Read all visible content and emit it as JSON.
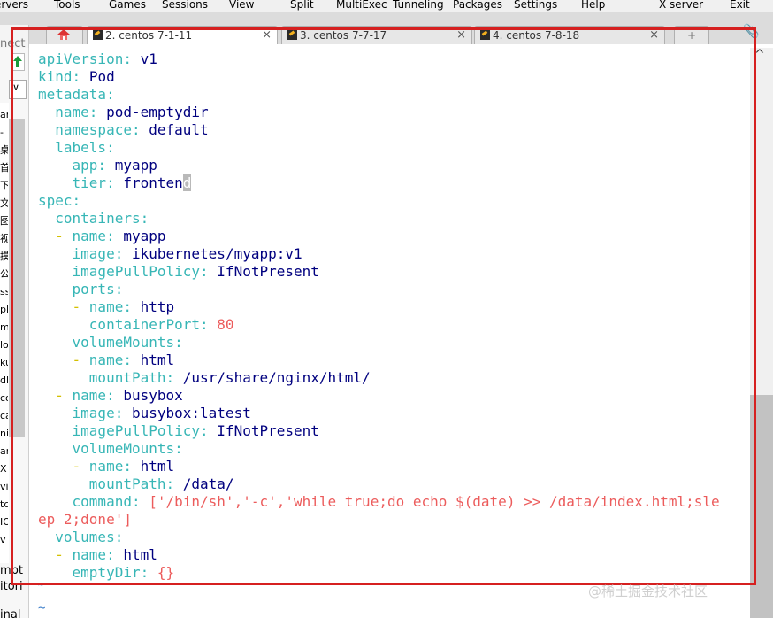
{
  "menu": {
    "items": [
      "ervers",
      "Tools",
      "Games",
      "Sessions",
      "View",
      "Split",
      "MultiExec",
      "Tunneling",
      "Packages",
      "Settings",
      "Help",
      "X server",
      "Exit"
    ]
  },
  "tabs": [
    {
      "label": "2. centos 7-1-11",
      "active": true
    },
    {
      "label": "3. centos 7-7-17",
      "active": false
    },
    {
      "label": "4. centos 7-8-18",
      "active": false
    }
  ],
  "sidebar": {
    "search_placeholder": "nect",
    "rows": [
      "ar",
      "桌",
      "首",
      "下",
      "文",
      "图",
      "视",
      "摸",
      "公",
      "ss",
      "pl",
      "m",
      "lo",
      "ku",
      "dl",
      "co",
      "ca",
      "ni",
      "an",
      "X",
      "vi",
      "tc",
      "IO",
      "v"
    ],
    "bottom": [
      "mpt",
      "itori",
      "inal"
    ]
  },
  "terminal": {
    "yaml": [
      {
        "indent": "",
        "key": "apiVersion",
        "value": "v1"
      },
      {
        "indent": "",
        "key": "kind",
        "value": "Pod"
      },
      {
        "indent": "",
        "key": "metadata",
        "value": ""
      },
      {
        "indent": "  ",
        "key": "name",
        "value": "pod-emptydir"
      },
      {
        "indent": "  ",
        "key": "namespace",
        "value": "default"
      },
      {
        "indent": "  ",
        "key": "labels",
        "value": ""
      },
      {
        "indent": "    ",
        "key": "app",
        "value": "myapp"
      },
      {
        "indent": "    ",
        "key": "tier",
        "value": "fronten",
        "cursor": "d"
      },
      {
        "indent": "",
        "key": "spec",
        "value": ""
      },
      {
        "indent": "  ",
        "key": "containers",
        "value": ""
      },
      {
        "indent": "  ",
        "dash": true,
        "key": "name",
        "value": "myapp"
      },
      {
        "indent": "    ",
        "key": "image",
        "value": "ikubernetes/myapp:v1"
      },
      {
        "indent": "    ",
        "key": "imagePullPolicy",
        "value": "IfNotPresent"
      },
      {
        "indent": "    ",
        "key": "ports",
        "value": ""
      },
      {
        "indent": "    ",
        "dash": true,
        "key": "name",
        "value": "http"
      },
      {
        "indent": "      ",
        "key": "containerPort",
        "value": "80",
        "valueStyle": "s"
      },
      {
        "indent": "    ",
        "key": "volumeMounts",
        "value": ""
      },
      {
        "indent": "    ",
        "dash": true,
        "key": "name",
        "value": "html"
      },
      {
        "indent": "      ",
        "key": "mountPath",
        "value": "/usr/share/nginx/html/"
      },
      {
        "indent": "  ",
        "dash": true,
        "key": "name",
        "value": "busybox"
      },
      {
        "indent": "    ",
        "key": "image",
        "value": "busybox:latest"
      },
      {
        "indent": "    ",
        "key": "imagePullPolicy",
        "value": "IfNotPresent"
      },
      {
        "indent": "    ",
        "key": "volumeMounts",
        "value": ""
      },
      {
        "indent": "    ",
        "dash": true,
        "key": "name",
        "value": "html"
      },
      {
        "indent": "      ",
        "key": "mountPath",
        "value": "/data/"
      },
      {
        "indent": "    ",
        "key": "command",
        "value": "['/bin/sh','-c','while true;do echo $(date) >> /data/index.html;sle",
        "valueStyle": "s"
      },
      {
        "indent": "",
        "key": "",
        "value": "ep 2;done']",
        "valueStyle": "s",
        "plain": true
      },
      {
        "indent": "  ",
        "key": "volumes",
        "value": ""
      },
      {
        "indent": "  ",
        "dash": true,
        "key": "name",
        "value": "html"
      },
      {
        "indent": "    ",
        "key": "emptyDir",
        "value": "{}",
        "valueStyle": "s"
      }
    ],
    "tilde": [
      "~",
      "~"
    ]
  },
  "watermark": "@稀土掘金技术社区",
  "colors": {
    "highlight": "#d62020",
    "yaml_key": "#37b6b6",
    "yaml_value": "#00007f",
    "yaml_string": "#ec5c5c",
    "yaml_dash": "#d4c000"
  }
}
